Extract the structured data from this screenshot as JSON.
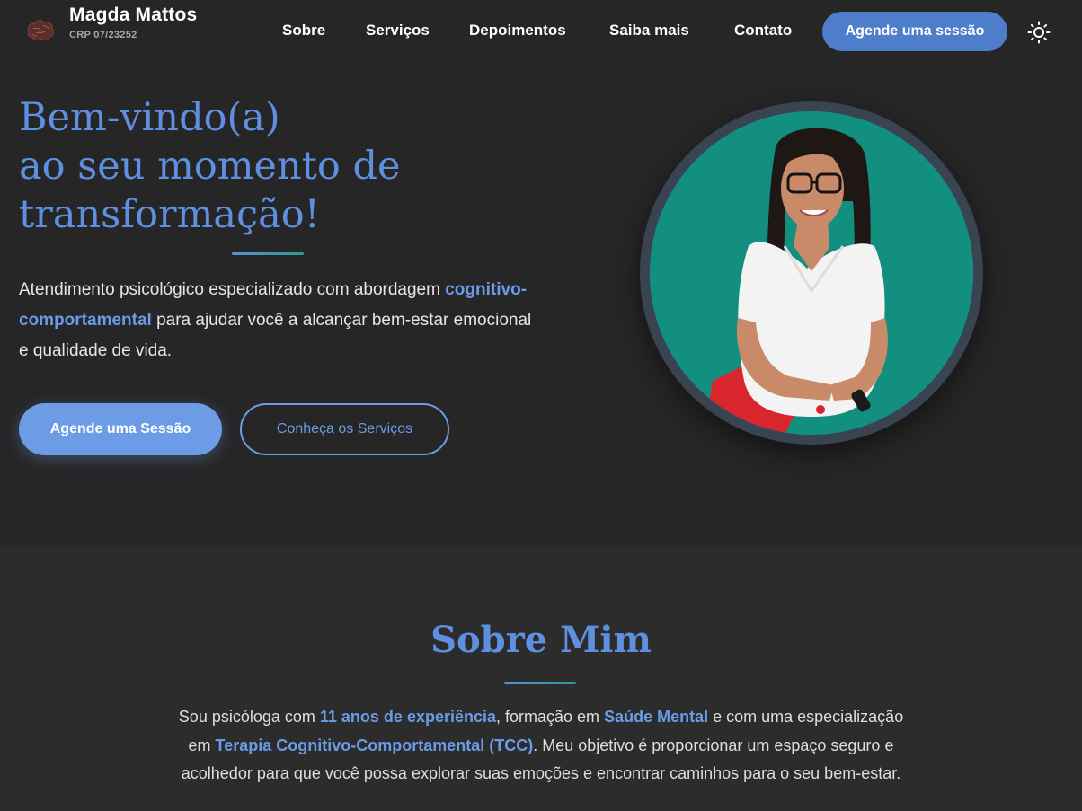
{
  "brand": {
    "name": "Magda Mattos",
    "subtitle": "CRP 07/23252"
  },
  "nav": {
    "items": [
      {
        "label": "Sobre"
      },
      {
        "label": "Serviços"
      },
      {
        "label": "Depoimentos"
      },
      {
        "label": "Saiba mais"
      },
      {
        "label": "Contato"
      }
    ],
    "cta_label": "Agende uma sessão",
    "theme_icon": "sun-icon"
  },
  "hero": {
    "title_lines": [
      "Bem-vindo(a)",
      "ao seu momento de",
      "transformação!"
    ],
    "intro_before": "Atendimento psicológico especializado com abordagem ",
    "intro_highlight": "cognitivo-comportamental",
    "intro_after": " para ajudar você a alcançar bem-estar emocional e qualidade de vida.",
    "primary_button": "Agende uma Sessão",
    "secondary_button": "Conheça os Serviços"
  },
  "about": {
    "title": "Sobre Mim",
    "p1": "Sou psicóloga com ",
    "h1": "11 anos de experiência",
    "p2": ", formação em ",
    "h2": "Saúde Mental",
    "p3": " e com uma especialização em ",
    "h3": "Terapia Cognitivo-Comportamental (TCC)",
    "p4": ". Meu objetivo é proporcionar um espaço seguro e acolhedor para que você possa explorar suas emoções e encontrar caminhos para o seu bem-estar."
  },
  "colors": {
    "background": "#262627",
    "accent": "#5f8fe0",
    "button": "#6c9ce6",
    "nav_cta": "#4e7dcc",
    "portrait_bg": "#128f7e"
  }
}
